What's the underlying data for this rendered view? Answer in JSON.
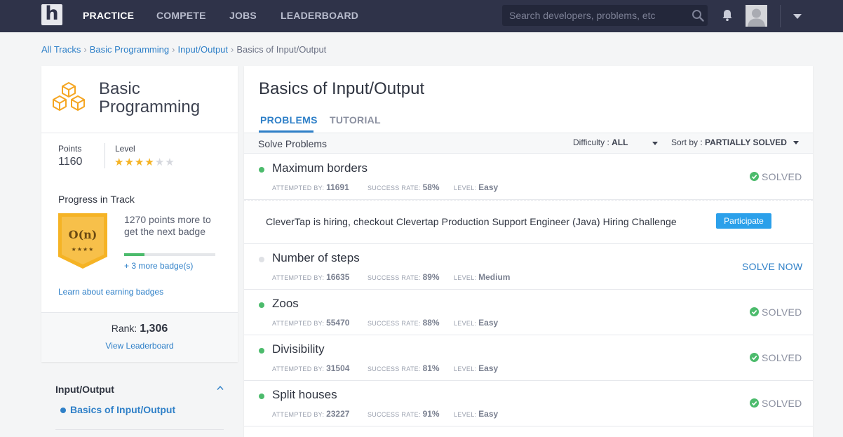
{
  "nav": {
    "logo_letter": "h",
    "links": [
      "PRACTICE",
      "COMPETE",
      "JOBS",
      "LEADERBOARD"
    ],
    "search_placeholder": "Search developers, problems, etc"
  },
  "breadcrumb": [
    "All Tracks",
    "Basic Programming",
    "Input/Output",
    "Basics of Input/Output"
  ],
  "track": {
    "title": "Basic Programming",
    "points_label": "Points",
    "points": "1160",
    "level_label": "Level",
    "level_stars": 4,
    "level_max": 6,
    "progress_title": "Progress in Track",
    "badge_symbol": "O(n)",
    "badge_stars": "★★★★",
    "badge_text": "1270 points more to get the next badge",
    "badge_progress": 0.22,
    "more_badges": "+ 3 more badge(s)",
    "learn_link": "Learn about earning badges",
    "rank_label": "Rank:",
    "rank": "1,306",
    "leaderboard_link": "View Leaderboard"
  },
  "topics": {
    "heading": "Input/Output",
    "current": "Basics of Input/Output"
  },
  "main": {
    "title": "Basics of Input/Output",
    "tabs": [
      "PROBLEMS",
      "TUTORIAL"
    ],
    "solve_label": "Solve Problems",
    "difficulty_label": "Difficulty :",
    "difficulty_value": "ALL",
    "sort_label": "Sort by :",
    "sort_value": "PARTIALLY SOLVED",
    "meta_labels": {
      "attempted": "ATTEMPTED BY:",
      "success": "SUCCESS RATE:",
      "level": "LEVEL:"
    },
    "solved_label": "SOLVED",
    "solve_now_label": "SOLVE NOW",
    "problems": [
      {
        "title": "Maximum borders",
        "attempted": "11691",
        "success": "58%",
        "level": "Easy",
        "status": "solved"
      },
      {
        "title": "Number of steps",
        "attempted": "16635",
        "success": "89%",
        "level": "Medium",
        "status": "unsolved"
      },
      {
        "title": "Zoos",
        "attempted": "55470",
        "success": "88%",
        "level": "Easy",
        "status": "solved"
      },
      {
        "title": "Divisibility",
        "attempted": "31504",
        "success": "81%",
        "level": "Easy",
        "status": "solved"
      },
      {
        "title": "Split houses",
        "attempted": "23227",
        "success": "91%",
        "level": "Easy",
        "status": "solved"
      }
    ],
    "promo": {
      "text": "CleverTap is hiring, checkout Clevertap Production Support Engineer (Java) Hiring Challenge",
      "button": "Participate"
    }
  },
  "colors": {
    "nav_bg": "#2f3349",
    "accent": "#2f80c8",
    "solved_green": "#4cbb6c",
    "star": "#f5b325",
    "badge": "#f5b325",
    "button": "#2ba0ea"
  }
}
